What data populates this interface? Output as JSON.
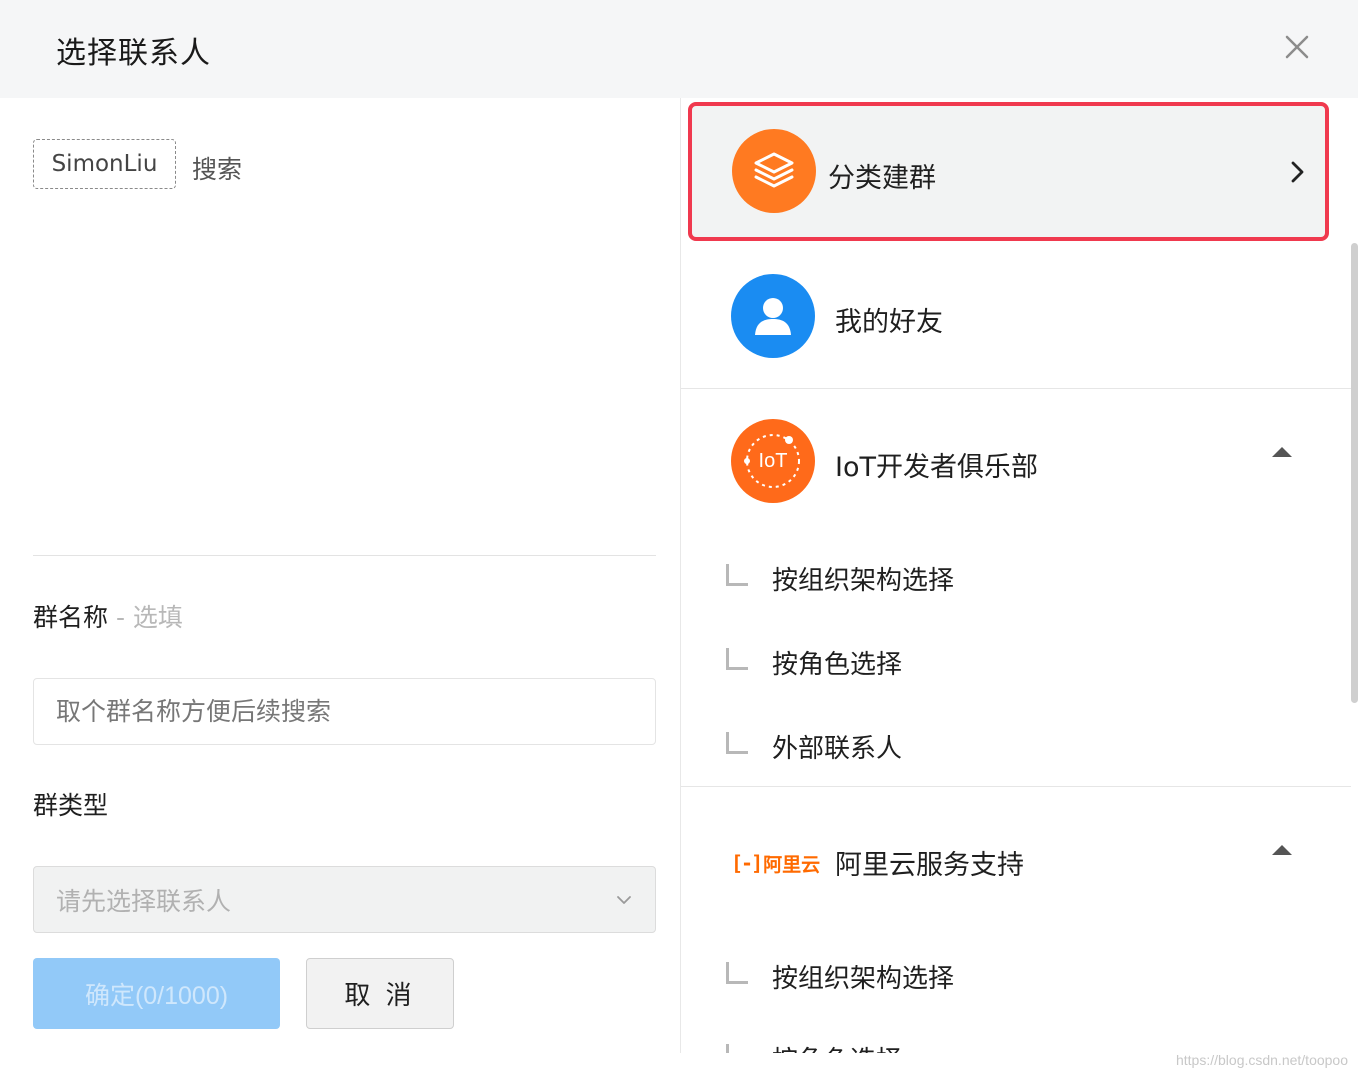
{
  "dialog": {
    "title": "选择联系人"
  },
  "left": {
    "chip_label": "SimonLiu",
    "search_label": "搜索",
    "group_name_label": "群名称",
    "group_name_optional": " - 选填",
    "group_name_placeholder": "取个群名称方便后续搜索",
    "group_type_label": "群类型",
    "group_type_placeholder": "请先选择联系人",
    "confirm_label": "确定(0/1000)",
    "cancel_label": "取 消"
  },
  "right": {
    "category": {
      "label": "分类建群",
      "accent": "#ff7a21"
    },
    "friends": {
      "label": "我的好友",
      "accent": "#1a8cf2"
    },
    "iot": {
      "label": "IoT开发者俱乐部",
      "logo_text": "IoT",
      "accent": "#ff7a21",
      "subitems": [
        "按组织架构选择",
        "按角色选择",
        "外部联系人"
      ]
    },
    "aliyun": {
      "label": "阿里云服务支持",
      "brand_text": "阿里云",
      "accent": "#ff6a00",
      "subitems": [
        "按组织架构选择",
        "按角色选择"
      ]
    }
  },
  "watermark": "https://blog.csdn.net/toopoo"
}
